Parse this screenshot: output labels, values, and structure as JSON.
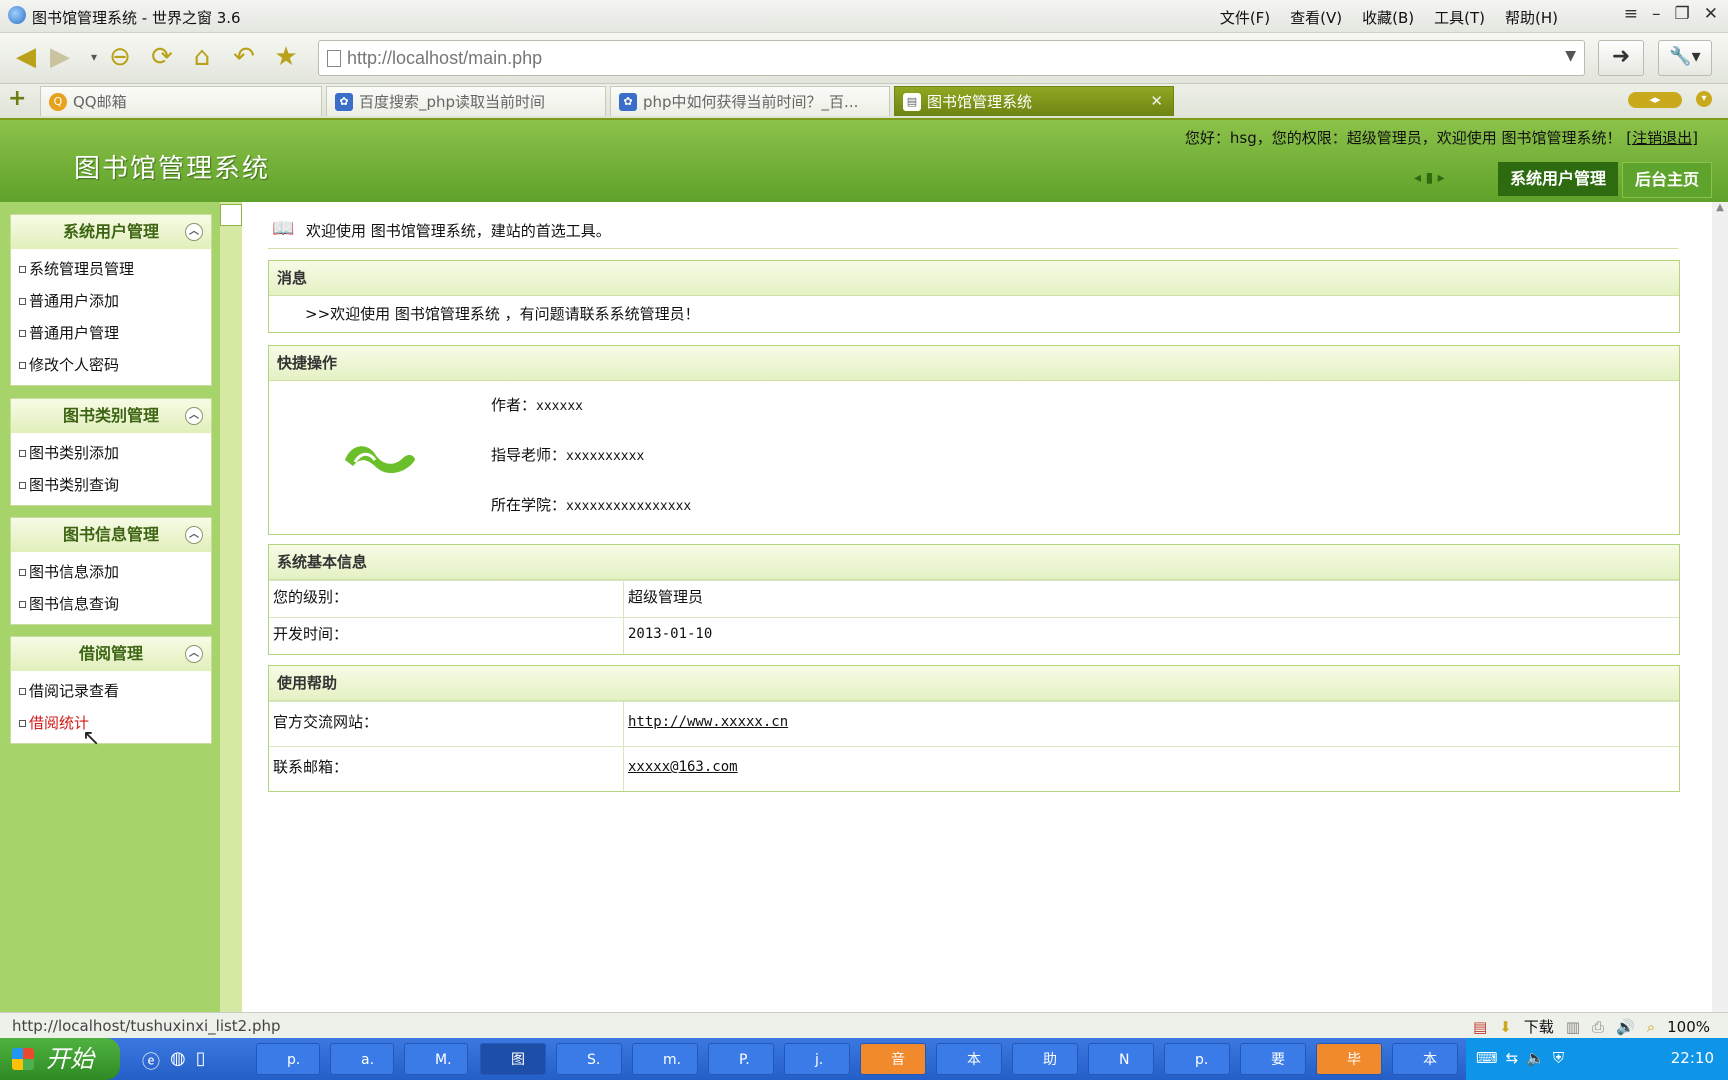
{
  "window": {
    "title": "图书馆管理系统 - 世界之窗 3.6",
    "menus": [
      "文件(F)",
      "查看(V)",
      "收藏(B)",
      "工具(T)",
      "帮助(H)"
    ]
  },
  "address": {
    "url": "http://localhost/main.php"
  },
  "tabs": [
    {
      "label": "QQ邮箱"
    },
    {
      "label": "百度搜索_php读取当前时间"
    },
    {
      "label": "php中如何获得当前时间？_百..."
    },
    {
      "label": "图书馆管理系统"
    }
  ],
  "header": {
    "site_title": "图书馆管理系统",
    "greeting": "您好：hsg，您的权限：超级管理员，欢迎使用 图书馆管理系统！",
    "logout": "[注销退出]",
    "tab_active": "系统用户管理",
    "tab_home": "后台主页"
  },
  "sidebar": {
    "groups": [
      {
        "title": "系统用户管理",
        "items": [
          "系统管理员管理",
          "普通用户添加",
          "普通用户管理",
          "修改个人密码"
        ]
      },
      {
        "title": "图书类别管理",
        "items": [
          "图书类别添加",
          "图书类别查询"
        ]
      },
      {
        "title": "图书信息管理",
        "items": [
          "图书信息添加",
          "图书信息查询"
        ]
      },
      {
        "title": "借阅管理",
        "items": [
          "借阅记录查看",
          "借阅统计"
        ]
      }
    ]
  },
  "main": {
    "welcome": "欢迎使用 图书馆管理系统，建站的首选工具。",
    "message_title": "消息",
    "message_text": ">>欢迎使用 图书馆管理系统 ，有问题请联系系统管理员！",
    "quick_title": "快捷操作",
    "author_label": "作者：",
    "author_value": "xxxxxx",
    "teacher_label": "指导老师：",
    "teacher_value": "xxxxxxxxxx",
    "college_label": "所在学院：",
    "college_value": "xxxxxxxxxxxxxxxx",
    "sysinfo_title": "系统基本信息",
    "level_label": "您的级别：",
    "level_value": "超级管理员",
    "devtime_label": "开发时间：",
    "devtime_value": "2013-01-10",
    "help_title": "使用帮助",
    "site_label": "官方交流网站：",
    "site_value": "http://www.xxxxx.cn",
    "email_label": "联系邮箱：",
    "email_value": "xxxxx@163.com"
  },
  "status": {
    "url": "http://localhost/tushuxinxi_list2.php",
    "download": "下载",
    "zoom": "100%"
  },
  "taskbar": {
    "start": "开始",
    "buttons": [
      "p.",
      "a.",
      "M.",
      "图",
      "S.",
      "m.",
      "P.",
      "j.",
      "音",
      "本",
      "助",
      "N",
      "p.",
      "要",
      "毕",
      "本"
    ],
    "clock": "22:10"
  }
}
